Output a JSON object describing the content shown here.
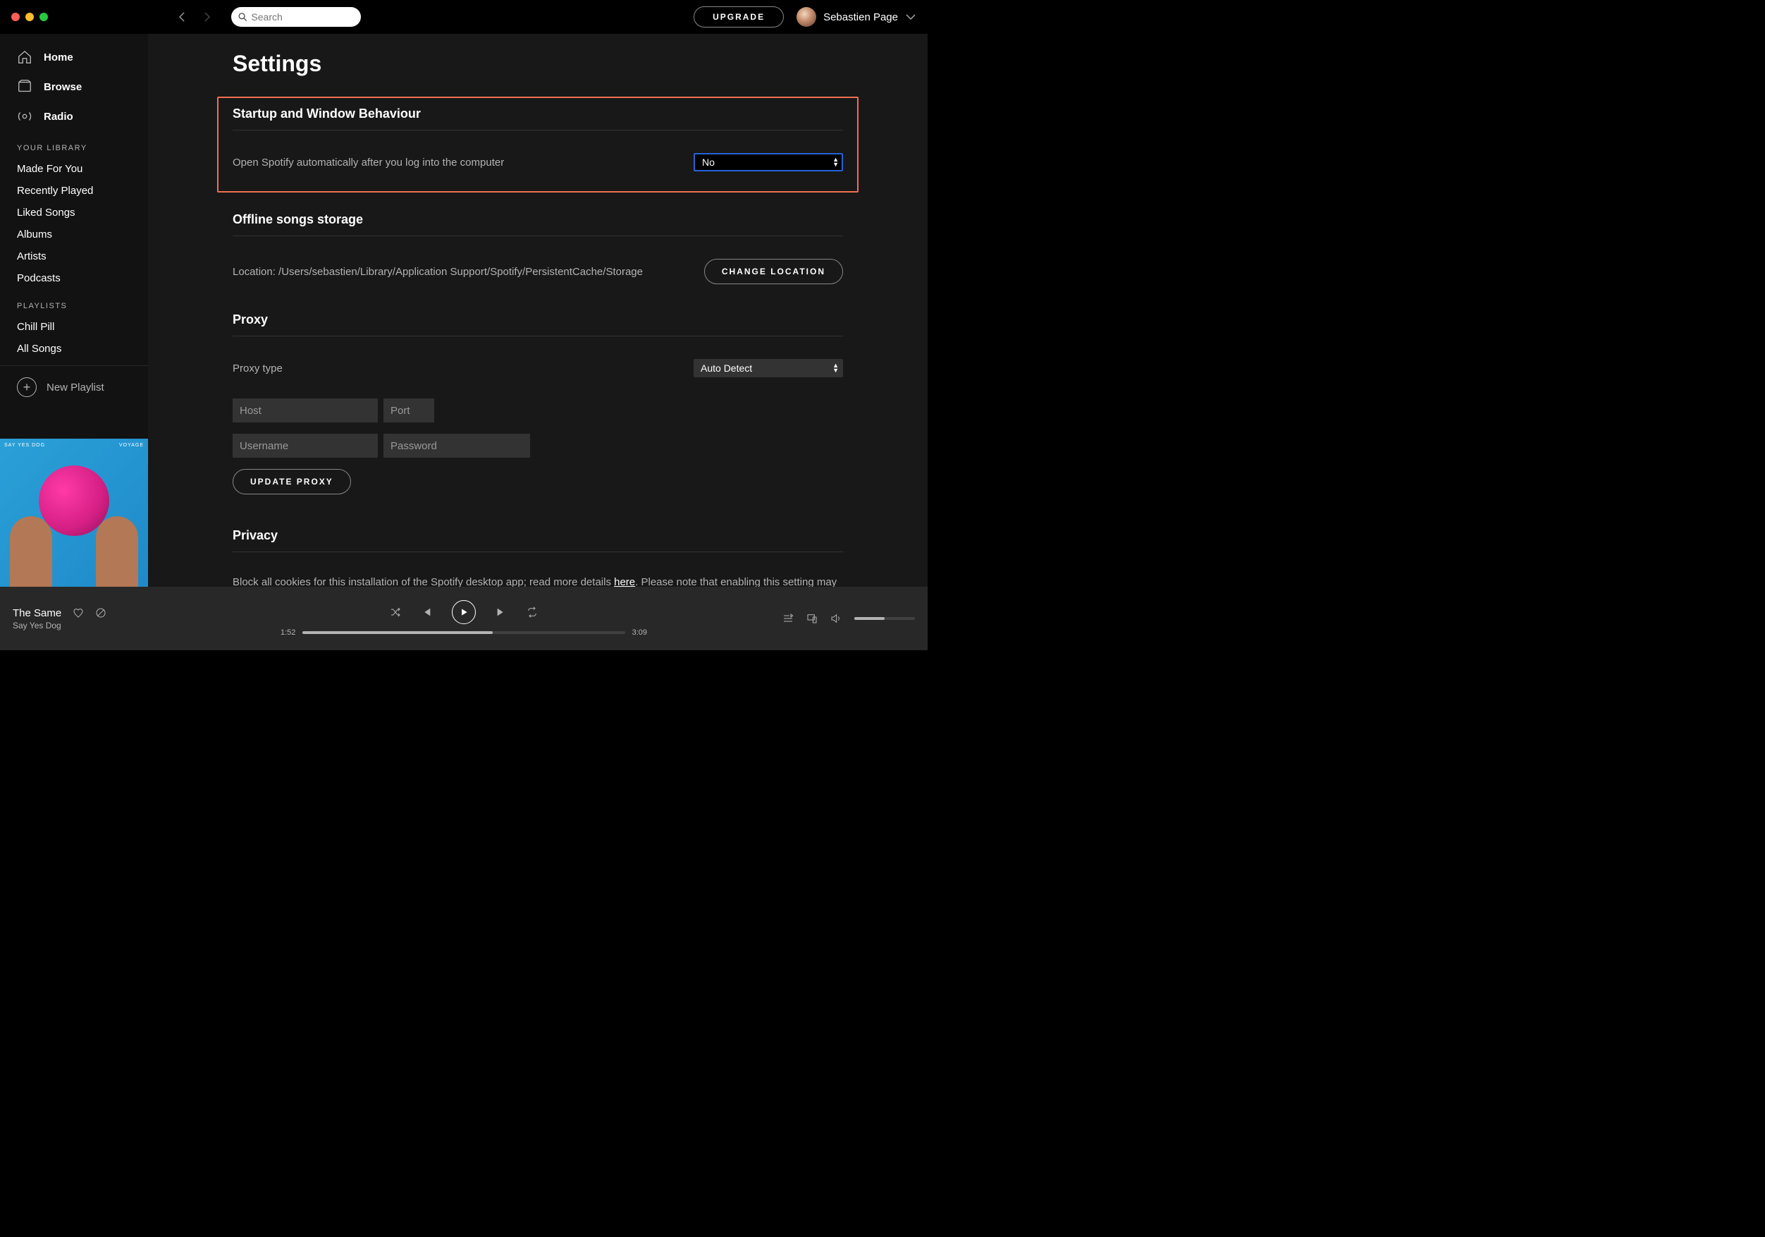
{
  "header": {
    "search_placeholder": "Search",
    "upgrade_label": "UPGRADE",
    "username": "Sebastien Page"
  },
  "sidebar": {
    "main": [
      {
        "label": "Home"
      },
      {
        "label": "Browse"
      },
      {
        "label": "Radio"
      }
    ],
    "library_heading": "YOUR LIBRARY",
    "library": [
      {
        "label": "Made For You"
      },
      {
        "label": "Recently Played"
      },
      {
        "label": "Liked Songs"
      },
      {
        "label": "Albums"
      },
      {
        "label": "Artists"
      },
      {
        "label": "Podcasts"
      }
    ],
    "playlists_heading": "PLAYLISTS",
    "playlists": [
      {
        "label": "Chill Pill"
      },
      {
        "label": "All Songs"
      }
    ],
    "new_playlist_label": "New Playlist",
    "album_top_left": "SAY YES DOG",
    "album_top_right": "VOYAGE"
  },
  "settings": {
    "page_title": "Settings",
    "startup": {
      "heading": "Startup and Window Behaviour",
      "open_auto_label": "Open Spotify automatically after you log into the computer",
      "open_auto_value": "No"
    },
    "offline": {
      "heading": "Offline songs storage",
      "location_text": "Location: /Users/sebastien/Library/Application Support/Spotify/PersistentCache/Storage",
      "change_label": "CHANGE LOCATION"
    },
    "proxy": {
      "heading": "Proxy",
      "type_label": "Proxy type",
      "type_value": "Auto Detect",
      "host_placeholder": "Host",
      "port_placeholder": "Port",
      "username_placeholder": "Username",
      "password_placeholder": "Password",
      "update_label": "UPDATE PROXY"
    },
    "privacy": {
      "heading": "Privacy",
      "text_before": "Block all cookies for this installation of the Spotify desktop app; read more details ",
      "link": "here",
      "text_after": ". Please note that enabling this setting may negatively impact your Spotify experience. Changes will be applied after restarting your app."
    }
  },
  "player": {
    "track_title": "The Same",
    "artist": "Say Yes Dog",
    "elapsed": "1:52",
    "duration": "3:09",
    "progress_percent": 59
  }
}
